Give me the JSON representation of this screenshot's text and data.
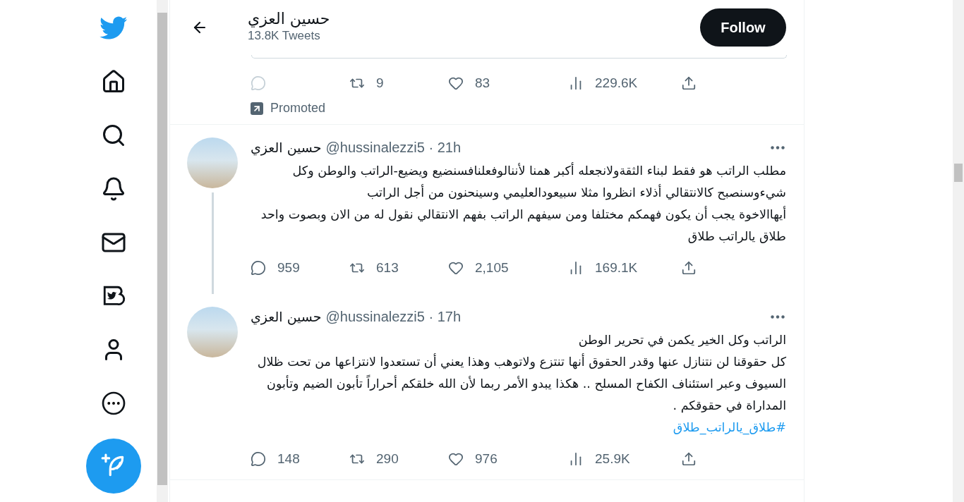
{
  "header": {
    "name": "حسين العزي",
    "tweet_count": "13.8K Tweets",
    "follow_button": "Follow"
  },
  "promoted": {
    "label": "Promoted",
    "actions": {
      "reply": {
        "disabled": true
      },
      "retweet": {
        "count": "9",
        "disabled": false
      },
      "like": {
        "count": "83",
        "disabled": false
      },
      "views": {
        "count": "229.6K",
        "disabled": false
      },
      "share": {
        "disabled": false
      }
    }
  },
  "tweets": [
    {
      "name": "حسين العزي",
      "handle_time": "@hussinalezzi5 · 21h",
      "thread": true,
      "paragraphs": [
        {
          "kind": "text",
          "text": "مطلب الراتب هو فقط لبناء الثقةولانجعله أكبر همنا لأننالوفعلنافسنضيع ويضيع-الراتب والوطن وكل شيءوسنصبح كالانتقالي أذلاء انظروا مثلا سبيعودالعليمي وسينحنون من أجل الراتب"
        },
        {
          "kind": "text",
          "text": "أيهاالاخوة يجب أن يكون فهمكم مختلفا ومن سيفهم الراتب بفهم الانتقالي نقول له من الان وبصوت واحد"
        },
        {
          "kind": "text",
          "text": "طلاق يالراتب طلاق"
        }
      ],
      "actions": {
        "reply": {
          "count": "959",
          "disabled": false
        },
        "retweet": {
          "count": "613",
          "disabled": false
        },
        "like": {
          "count": "2,105",
          "disabled": false
        },
        "views": {
          "count": "169.1K",
          "disabled": false
        },
        "share": {
          "disabled": false
        }
      }
    },
    {
      "name": "حسين العزي",
      "handle_time": "@hussinalezzi5 · 17h",
      "thread": false,
      "paragraphs": [
        {
          "kind": "text",
          "text": "الراتب وكل الخير يكمن في تحرير الوطن"
        },
        {
          "kind": "text",
          "text": "كل حقوقنا لن نتنازل عنها وقدر الحقوق أنها تنتزع ولاتوهب وهذا يعني أن تستعدوا لانتزاعها من تحت ظلال السيوف وعبر استئناف الكفاح المسلح .. هكذا يبدو الأمر ربما لأن الله خلقكم أحراراً تأبون الضيم وتأبون المداراة في حقوقكم ."
        },
        {
          "kind": "hashtag",
          "text": "#طلاق_يالراتب_طلاق"
        }
      ],
      "actions": {
        "reply": {
          "count": "148",
          "disabled": false
        },
        "retweet": {
          "count": "290",
          "disabled": false
        },
        "like": {
          "count": "976",
          "disabled": false
        },
        "views": {
          "count": "25.9K",
          "disabled": false
        },
        "share": {
          "disabled": false
        }
      }
    }
  ]
}
